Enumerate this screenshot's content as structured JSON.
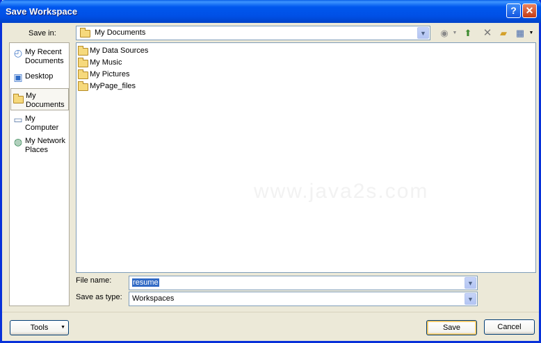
{
  "window": {
    "title": "Save Workspace",
    "help_glyph": "?",
    "close_glyph": "✕",
    "titlebar_color": "#0054E3"
  },
  "save_in": {
    "label": "Save in:",
    "value": "My Documents"
  },
  "toolbar": {
    "back_icon": "back-icon",
    "up_icon": "up-folder-icon",
    "delete_icon": "delete-icon",
    "new_folder_icon": "new-folder-icon",
    "views_icon": "views-menu-icon"
  },
  "places": [
    {
      "label": "My Recent Documents",
      "icon": "recent-documents-icon"
    },
    {
      "label": "Desktop",
      "icon": "desktop-icon"
    },
    {
      "label": "My Documents",
      "icon": "my-documents-icon"
    },
    {
      "label": "My Computer",
      "icon": "my-computer-icon"
    },
    {
      "label": "My Network Places",
      "icon": "network-places-icon"
    }
  ],
  "files": [
    {
      "name": "My Data Sources",
      "icon": "data-sources-folder-icon"
    },
    {
      "name": "My Music",
      "icon": "music-folder-icon"
    },
    {
      "name": "My Pictures",
      "icon": "pictures-folder-icon"
    },
    {
      "name": "MyPage_files",
      "icon": "folder-icon"
    }
  ],
  "watermark": "www.java2s.com",
  "file_name": {
    "label": "File name:",
    "value": "resume"
  },
  "save_as_type": {
    "label": "Save as type:",
    "value": "Workspaces"
  },
  "buttons": {
    "tools": "Tools",
    "save": "Save",
    "cancel": "Cancel"
  }
}
